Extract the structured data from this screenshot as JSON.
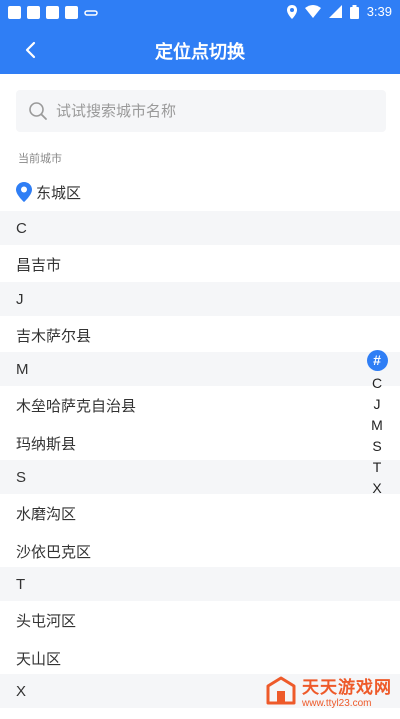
{
  "status_bar": {
    "time": "3:39"
  },
  "nav": {
    "title": "定位点切换"
  },
  "search": {
    "placeholder": "试试搜索城市名称"
  },
  "current": {
    "label": "当前城市",
    "city": "东城区"
  },
  "groups": [
    {
      "letter": "C",
      "cities": [
        "昌吉市"
      ]
    },
    {
      "letter": "J",
      "cities": [
        "吉木萨尔县"
      ]
    },
    {
      "letter": "M",
      "cities": [
        "木垒哈萨克自治县",
        "玛纳斯县"
      ]
    },
    {
      "letter": "S",
      "cities": [
        "水磨沟区",
        "沙依巴克区"
      ]
    },
    {
      "letter": "T",
      "cities": [
        "头屯河区",
        "天山区"
      ]
    },
    {
      "letter": "X",
      "cities": []
    }
  ],
  "index_bar": [
    "#",
    "C",
    "J",
    "M",
    "S",
    "T",
    "X"
  ],
  "watermark": {
    "title": "天天游戏网",
    "url": "www.ttyl23.com"
  },
  "colors": {
    "primary": "#2f7ef5",
    "group_bg": "#f5f6f8",
    "watermark": "#ee5a2a"
  }
}
